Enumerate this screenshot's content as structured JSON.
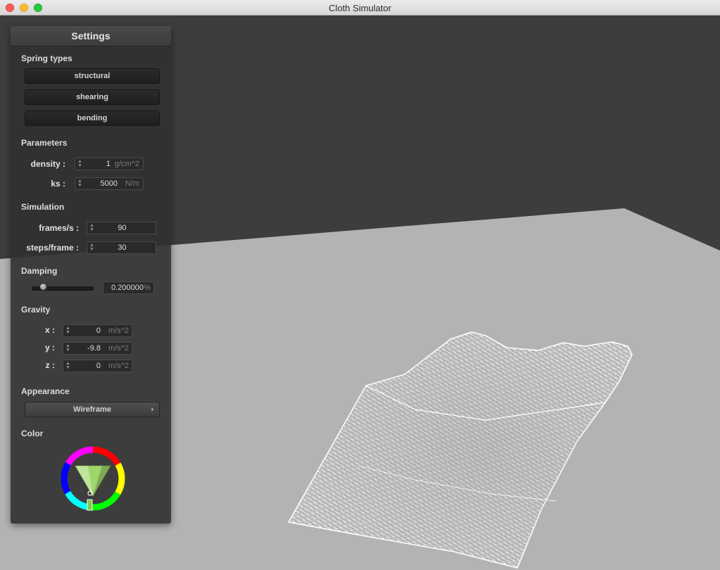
{
  "window": {
    "title": "Cloth Simulator"
  },
  "settings": {
    "title": "Settings",
    "spring_types": {
      "heading": "Spring types",
      "buttons": [
        "structural",
        "shearing",
        "bending"
      ]
    },
    "parameters": {
      "heading": "Parameters",
      "density": {
        "label": "density :",
        "value": "1",
        "unit": "g/cm^2"
      },
      "ks": {
        "label": "ks :",
        "value": "5000",
        "unit": "N/m"
      }
    },
    "simulation": {
      "heading": "Simulation",
      "frames": {
        "label": "frames/s :",
        "value": "90"
      },
      "steps": {
        "label": "steps/frame :",
        "value": "30"
      }
    },
    "damping": {
      "heading": "Damping",
      "value": "0.200000",
      "unit": "%",
      "slider_fraction": 0.2
    },
    "gravity": {
      "heading": "Gravity",
      "x": {
        "label": "x :",
        "value": "0",
        "unit": "m/s^2"
      },
      "y": {
        "label": "y :",
        "value": "-9.8",
        "unit": "m/s^2"
      },
      "z": {
        "label": "z :",
        "value": "0",
        "unit": "m/s^2"
      }
    },
    "appearance": {
      "heading": "Appearance",
      "selected": "Wireframe",
      "arrow": "›"
    },
    "color": {
      "heading": "Color",
      "selected_color": "#9ed66a"
    }
  },
  "scene": {
    "background_color": "#3d3d3d",
    "floor_color": "#b3b3b3",
    "cloth_color": "#ffffff",
    "render_mode": "wireframe"
  }
}
